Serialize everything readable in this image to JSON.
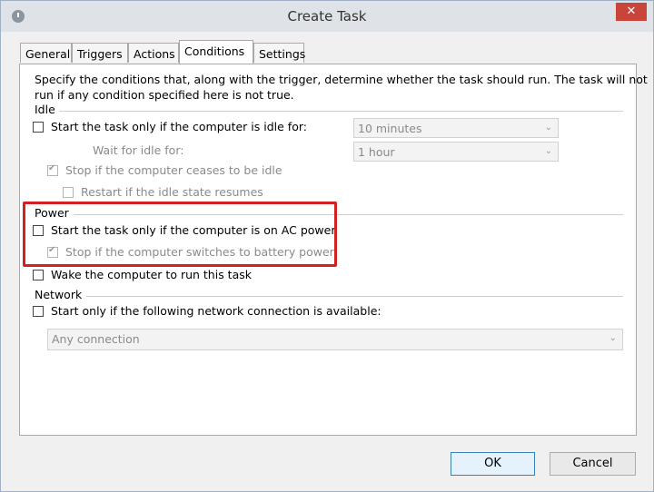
{
  "window": {
    "title": "Create Task",
    "close_glyph": "✕"
  },
  "tabs": [
    {
      "label": "General"
    },
    {
      "label": "Triggers"
    },
    {
      "label": "Actions"
    },
    {
      "label": "Conditions"
    },
    {
      "label": "Settings"
    }
  ],
  "conditions": {
    "intro_line1": "Specify the conditions that, along with the trigger, determine whether the task should run.  The task will not",
    "intro_line2": "run  if any condition specified here is not true.",
    "idle": {
      "header": "Idle",
      "start_if_idle": {
        "label": "Start the task only if the computer is idle for:",
        "checked": false
      },
      "idle_for": {
        "value": "10 minutes"
      },
      "wait_label": "Wait for idle for:",
      "wait_for": {
        "value": "1 hour"
      },
      "stop_if_ceases": {
        "label": "Stop if the computer ceases to be idle",
        "checked": true
      },
      "restart_if_resumes": {
        "label": "Restart if the idle state resumes",
        "checked": false
      }
    },
    "power": {
      "header": "Power",
      "ac_power": {
        "label": "Start the task only if the computer is on AC power",
        "checked": false
      },
      "stop_on_battery": {
        "label": "Stop if the computer switches to battery power",
        "checked": true
      },
      "wake": {
        "label": "Wake the computer to run this task",
        "checked": false
      }
    },
    "network": {
      "header": "Network",
      "start_if_network": {
        "label": "Start only if the following network connection is available:",
        "checked": false
      },
      "connection": {
        "value": "Any connection"
      }
    }
  },
  "buttons": {
    "ok": "OK",
    "cancel": "Cancel"
  },
  "colors": {
    "highlight": "#d32020",
    "close": "#c9453a"
  }
}
